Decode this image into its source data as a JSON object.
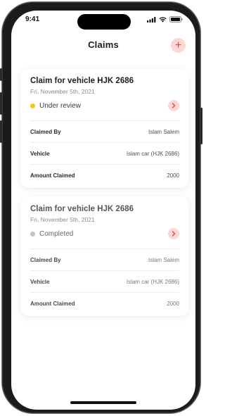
{
  "status_bar": {
    "time": "9:41"
  },
  "header": {
    "title": "Claims",
    "add_label": "+"
  },
  "claims": [
    {
      "title": "Claim for vehicle HJK 2686",
      "date": "Fri, November 5th, 2021",
      "status": "Under review",
      "status_color": "#f5c518",
      "rows": [
        {
          "label": "Claimed By",
          "value": "Islam Salem"
        },
        {
          "label": "Vehicle",
          "value": "Islam car (HJK 2686)"
        },
        {
          "label": "Amount Claimed",
          "value": "2000"
        }
      ]
    },
    {
      "title": "Claim for vehicle HJK 2686",
      "date": "Fri, November 5th, 2021",
      "status": "Completed",
      "status_color": "#c4c4c6",
      "rows": [
        {
          "label": "Claimed By",
          "value": "Islam Salem"
        },
        {
          "label": "Vehicle",
          "value": "Islam car (HJK 2686)"
        },
        {
          "label": "Amount Claimed",
          "value": "2000"
        }
      ]
    }
  ],
  "colors": {
    "accent": "#e2463b",
    "accent_soft": "#fbd8d5"
  },
  "icons": [
    "add-icon",
    "chevron-right-icon",
    "signal-icon",
    "wifi-icon",
    "battery-icon"
  ]
}
